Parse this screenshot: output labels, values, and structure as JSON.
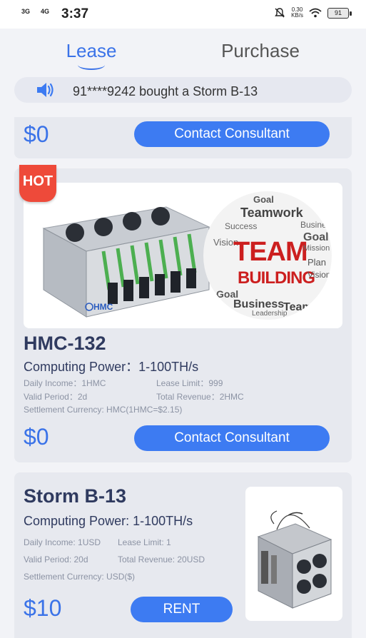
{
  "status_bar": {
    "network_1": "3G",
    "network_2": "4G",
    "time": "3:37",
    "speed_value": "0.30",
    "speed_unit": "KB/s",
    "battery": "91"
  },
  "tabs": [
    {
      "label": "Lease",
      "active": true
    },
    {
      "label": "Purchase",
      "active": false
    }
  ],
  "notice": {
    "icon": "speaker-icon",
    "text": "91****9242 bought a Storm B-13"
  },
  "products": [
    {
      "price": "$0",
      "button_label": "Contact Consultant"
    },
    {
      "badge": "HOT",
      "name": "HMC-132",
      "computing_power": "Computing Power：1-100TH/s",
      "daily_income": "Daily Income：1HMC",
      "lease_limit": "Lease Limit：999",
      "valid_period": "Valid Period：2d",
      "total_revenue": "Total Revenue：2HMC",
      "settlement_currency": "Settlement Currency: HMC(1HMC=$2.15)",
      "price": "$0",
      "button_label": "Contact Consultant",
      "image_text": {
        "brand": "HMC",
        "team": "TEAM",
        "building": "BUILDING",
        "words": [
          "Goal",
          "Teamwork",
          "Plan",
          "Success",
          "Vision",
          "Business",
          "Team",
          "Leadership",
          "Mission"
        ]
      }
    },
    {
      "name": "Storm B-13",
      "computing_power": "Computing Power: 1-100TH/s",
      "daily_income": "Daily Income: 1USD",
      "lease_limit": "Lease Limit: 1",
      "valid_period": "Valid Period: 20d",
      "total_revenue": "Total Revenue: 20USD",
      "settlement_currency": "Settlement Currency: USD($)",
      "price": "$10",
      "button_label": "RENT"
    }
  ],
  "colors": {
    "accent": "#3d7bf2",
    "price": "#3b73e8",
    "title": "#2f3a5f",
    "hot_badge": "#ee4a3a",
    "card_bg": "#e7e9ef"
  }
}
